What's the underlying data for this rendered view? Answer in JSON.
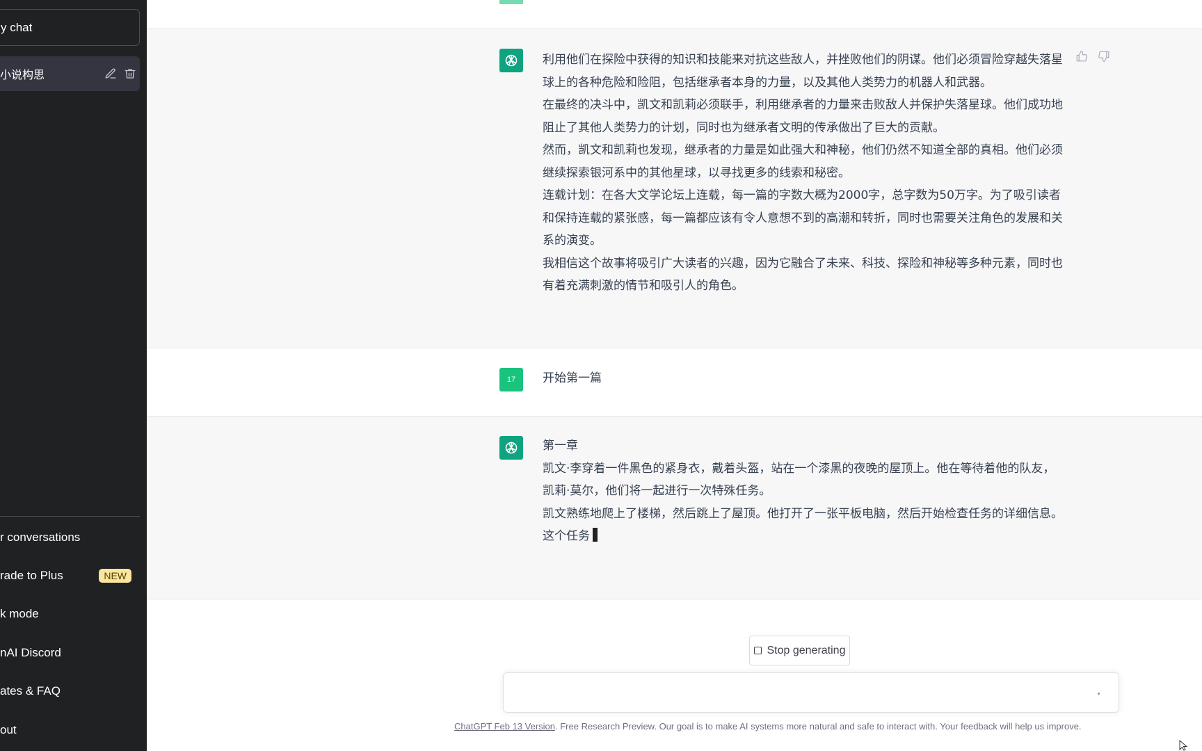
{
  "sidebar": {
    "new_chat": "y chat",
    "conversation": "小说构思",
    "menu": [
      {
        "label": "r conversations"
      },
      {
        "label": "rade to Plus",
        "badge": "NEW"
      },
      {
        "label": "k mode"
      },
      {
        "label": "nAI Discord"
      },
      {
        "label": "ates & FAQ"
      },
      {
        "label": "out"
      }
    ]
  },
  "messages": [
    {
      "role": "assistant",
      "paragraphs": [
        "利用他们在探险中获得的知识和技能来对抗这些敌人，并挫败他们的阴谋。他们必须冒险穿越失落星球上的各种危险和险阻，包括继承者本身的力量，以及其他人类势力的机器人和武器。",
        "在最终的决斗中，凯文和凯莉必须联手，利用继承者的力量来击败敌人并保护失落星球。他们成功地阻止了其他人类势力的计划，同时也为继承者文明的传承做出了巨大的贡献。",
        "然而，凯文和凯莉也发现，继承者的力量是如此强大和神秘，他们仍然不知道全部的真相。他们必须继续探索银河系中的其他星球，以寻找更多的线索和秘密。",
        "连载计划：在各大文学论坛上连载，每一篇的字数大概为2000字，总字数为50万字。为了吸引读者和保持连载的紧张感，每一篇都应该有令人意想不到的高潮和转折，同时也需要关注角色的发展和关系的演变。",
        "我相信这个故事将吸引广大读者的兴趣，因为它融合了未来、科技、探险和神秘等多种元素，同时也有着充满刺激的情节和吸引人的角色。"
      ]
    },
    {
      "role": "user",
      "avatar": "17",
      "text": "开始第一篇"
    },
    {
      "role": "assistant",
      "paragraphs": [
        "第一章",
        "凯文·李穿着一件黑色的紧身衣，戴着头盔，站在一个漆黑的夜晚的屋顶上。他在等待着他的队友，凯莉·莫尔，他们将一起进行一次特殊任务。",
        "凯文熟练地爬上了楼梯，然后跳上了屋顶。他打开了一张平板电脑，然后开始检查任务的详细信息。",
        "这个任务"
      ]
    }
  ],
  "stop_button": "Stop generating",
  "footer": {
    "link": "ChatGPT Feb 13 Version",
    "text": ". Free Research Preview. Our goal is to make AI systems more natural and safe to interact with. Your feedback will help us improve."
  },
  "colors": {
    "sidebar": "#202123",
    "accent": "#10a37f",
    "badge": "#fae69e"
  }
}
